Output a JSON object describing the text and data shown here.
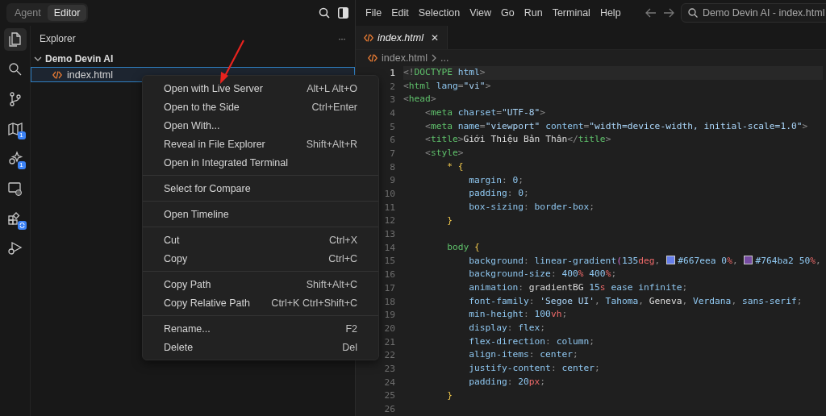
{
  "mode_toggle": [
    {
      "label": "Agent",
      "selected": false
    },
    {
      "label": "Editor",
      "selected": true
    }
  ],
  "menu_bar": [
    "File",
    "Edit",
    "Selection",
    "View",
    "Go",
    "Run",
    "Terminal",
    "Help"
  ],
  "command_center": {
    "value": "Demo Devin AI - index.html"
  },
  "activity_bar": [
    {
      "kind": "files",
      "selected": true
    },
    {
      "kind": "search",
      "selected": false
    },
    {
      "kind": "source-control",
      "selected": false
    },
    {
      "kind": "map",
      "selected": false,
      "badge": "1"
    },
    {
      "kind": "sparkle",
      "selected": false,
      "badge": "1"
    },
    {
      "kind": "remote",
      "selected": false
    },
    {
      "kind": "extensions",
      "selected": false,
      "sync": true
    },
    {
      "kind": "run",
      "selected": false
    }
  ],
  "explorer": {
    "title": "Explorer",
    "more": "···",
    "folder": {
      "name": "Demo Devin AI",
      "expanded": true,
      "children": [
        {
          "name": "index.html",
          "selected": true
        }
      ]
    }
  },
  "context_menu": [
    [
      {
        "label": "Open with Live Server",
        "shortcut": "Alt+L Alt+O"
      },
      {
        "label": "Open to the Side",
        "shortcut": "Ctrl+Enter"
      },
      {
        "label": "Open With..."
      },
      {
        "label": "Reveal in File Explorer",
        "shortcut": "Shift+Alt+R"
      },
      {
        "label": "Open in Integrated Terminal"
      }
    ],
    [
      {
        "label": "Select for Compare"
      }
    ],
    [
      {
        "label": "Open Timeline"
      }
    ],
    [
      {
        "label": "Cut",
        "shortcut": "Ctrl+X"
      },
      {
        "label": "Copy",
        "shortcut": "Ctrl+C"
      }
    ],
    [
      {
        "label": "Copy Path",
        "shortcut": "Shift+Alt+C"
      },
      {
        "label": "Copy Relative Path",
        "shortcut": "Ctrl+K Ctrl+Shift+C"
      }
    ],
    [
      {
        "label": "Rename...",
        "shortcut": "F2"
      },
      {
        "label": "Delete",
        "shortcut": "Del"
      }
    ]
  ],
  "tabs": [
    {
      "label": "index.html",
      "selected": true,
      "close": "✕"
    }
  ],
  "breadcrumb": {
    "file": "index.html",
    "rest": "..."
  },
  "code": [
    {
      "number": "1",
      "current": true,
      "tokens": [
        {
          "kind": "p",
          "text": "<!"
        },
        {
          "kind": "tag",
          "text": "DOCTYPE"
        },
        {
          "kind": "attr",
          "text": " html"
        },
        {
          "kind": "p",
          "text": ">"
        }
      ]
    },
    {
      "number": "2",
      "current": false,
      "tokens": [
        {
          "kind": "p",
          "text": "<"
        },
        {
          "kind": "tag",
          "text": "html"
        },
        {
          "kind": "attr",
          "text": " lang"
        },
        {
          "kind": "p",
          "text": "="
        },
        {
          "kind": "str",
          "text": "\"vi\""
        },
        {
          "kind": "p",
          "text": ">"
        }
      ]
    },
    {
      "number": "3",
      "current": false,
      "tokens": [
        {
          "kind": "p",
          "text": "<"
        },
        {
          "kind": "tag",
          "text": "head"
        },
        {
          "kind": "p",
          "text": ">"
        }
      ]
    },
    {
      "number": "4",
      "current": false,
      "tokens": [
        {
          "kind": "p",
          "text": "    <"
        },
        {
          "kind": "tag",
          "text": "meta"
        },
        {
          "kind": "attr",
          "text": " charset"
        },
        {
          "kind": "p",
          "text": "="
        },
        {
          "kind": "str",
          "text": "\"UTF-8\""
        },
        {
          "kind": "p",
          "text": ">"
        }
      ]
    },
    {
      "number": "5",
      "current": false,
      "tokens": [
        {
          "kind": "p",
          "text": "    <"
        },
        {
          "kind": "tag",
          "text": "meta"
        },
        {
          "kind": "attr",
          "text": " name"
        },
        {
          "kind": "p",
          "text": "="
        },
        {
          "kind": "str",
          "text": "\"viewport\""
        },
        {
          "kind": "attr",
          "text": " content"
        },
        {
          "kind": "p",
          "text": "="
        },
        {
          "kind": "str",
          "text": "\"width=device-width, initial-scale=1.0\""
        },
        {
          "kind": "p",
          "text": ">"
        }
      ]
    },
    {
      "number": "6",
      "current": false,
      "tokens": [
        {
          "kind": "p",
          "text": "    <"
        },
        {
          "kind": "tag",
          "text": "title"
        },
        {
          "kind": "p",
          "text": ">"
        },
        {
          "kind": "text",
          "text": "Giới Thiệu Bản Thân"
        },
        {
          "kind": "p",
          "text": "</"
        },
        {
          "kind": "tag",
          "text": "title"
        },
        {
          "kind": "p",
          "text": ">"
        }
      ]
    },
    {
      "number": "7",
      "current": false,
      "tokens": [
        {
          "kind": "p",
          "text": "    <"
        },
        {
          "kind": "tag",
          "text": "style"
        },
        {
          "kind": "p",
          "text": ">"
        }
      ]
    },
    {
      "number": "8",
      "current": false,
      "tokens": [
        {
          "kind": "brace",
          "text": "        * {"
        }
      ]
    },
    {
      "number": "9",
      "current": false,
      "tokens": [
        {
          "kind": "prop",
          "text": "            margin"
        },
        {
          "kind": "p",
          "text": ": "
        },
        {
          "kind": "val",
          "text": "0"
        },
        {
          "kind": "p",
          "text": ";"
        }
      ]
    },
    {
      "number": "10",
      "current": false,
      "tokens": [
        {
          "kind": "prop",
          "text": "            padding"
        },
        {
          "kind": "p",
          "text": ": "
        },
        {
          "kind": "val",
          "text": "0"
        },
        {
          "kind": "p",
          "text": ";"
        }
      ]
    },
    {
      "number": "11",
      "current": false,
      "tokens": [
        {
          "kind": "prop",
          "text": "            box-sizing"
        },
        {
          "kind": "p",
          "text": ": "
        },
        {
          "kind": "val",
          "text": "border-box"
        },
        {
          "kind": "p",
          "text": ";"
        }
      ]
    },
    {
      "number": "12",
      "current": false,
      "tokens": [
        {
          "kind": "brace",
          "text": "        }"
        }
      ]
    },
    {
      "number": "13",
      "current": false
    },
    {
      "number": "14",
      "current": false,
      "tokens": [
        {
          "kind": "sel",
          "text": "        body"
        },
        {
          "kind": "brace",
          "text": " {"
        }
      ]
    },
    {
      "number": "15",
      "current": false,
      "tokens": [
        {
          "kind": "prop",
          "text": "            background"
        },
        {
          "kind": "p",
          "text": ": "
        },
        {
          "kind": "val",
          "text": "linear-gradient"
        },
        {
          "kind": "paren",
          "text": "("
        },
        {
          "kind": "val",
          "text": "135"
        },
        {
          "kind": "unit",
          "text": "deg"
        },
        {
          "kind": "p",
          "text": ", "
        },
        {
          "kind": "swatch",
          "color": "#667eea"
        },
        {
          "kind": "val",
          "text": "#667eea 0"
        },
        {
          "kind": "unit",
          "text": "%"
        },
        {
          "kind": "p",
          "text": ", "
        },
        {
          "kind": "swatch",
          "color": "#764ba2"
        },
        {
          "kind": "val",
          "text": "#764ba2 50"
        },
        {
          "kind": "unit",
          "text": "%"
        },
        {
          "kind": "p",
          "text": ","
        }
      ]
    },
    {
      "number": "16",
      "current": false,
      "tokens": [
        {
          "kind": "prop",
          "text": "            background-size"
        },
        {
          "kind": "p",
          "text": ": "
        },
        {
          "kind": "val",
          "text": "400"
        },
        {
          "kind": "unit",
          "text": "%"
        },
        {
          "kind": "val",
          "text": " 400"
        },
        {
          "kind": "unit",
          "text": "%"
        },
        {
          "kind": "p",
          "text": ";"
        }
      ]
    },
    {
      "number": "17",
      "current": false,
      "tokens": [
        {
          "kind": "prop",
          "text": "            animation"
        },
        {
          "kind": "p",
          "text": ": "
        },
        {
          "kind": "text",
          "text": "gradientBG"
        },
        {
          "kind": "val",
          "text": " 15"
        },
        {
          "kind": "unit",
          "text": "s"
        },
        {
          "kind": "val",
          "text": " ease infinite"
        },
        {
          "kind": "p",
          "text": ";"
        }
      ]
    },
    {
      "number": "18",
      "current": false,
      "tokens": [
        {
          "kind": "prop",
          "text": "            font-family"
        },
        {
          "kind": "p",
          "text": ": "
        },
        {
          "kind": "str",
          "text": "'Segoe UI'"
        },
        {
          "kind": "p",
          "text": ", "
        },
        {
          "kind": "val",
          "text": "Tahoma"
        },
        {
          "kind": "p",
          "text": ", "
        },
        {
          "kind": "text",
          "text": "Geneva"
        },
        {
          "kind": "p",
          "text": ", "
        },
        {
          "kind": "val",
          "text": "Verdana"
        },
        {
          "kind": "p",
          "text": ", "
        },
        {
          "kind": "val",
          "text": "sans-serif"
        },
        {
          "kind": "p",
          "text": ";"
        }
      ]
    },
    {
      "number": "19",
      "current": false,
      "tokens": [
        {
          "kind": "prop",
          "text": "            min-height"
        },
        {
          "kind": "p",
          "text": ": "
        },
        {
          "kind": "val",
          "text": "100"
        },
        {
          "kind": "unit",
          "text": "vh"
        },
        {
          "kind": "p",
          "text": ";"
        }
      ]
    },
    {
      "number": "20",
      "current": false,
      "tokens": [
        {
          "kind": "prop",
          "text": "            display"
        },
        {
          "kind": "p",
          "text": ": "
        },
        {
          "kind": "val",
          "text": "flex"
        },
        {
          "kind": "p",
          "text": ";"
        }
      ]
    },
    {
      "number": "21",
      "current": false,
      "tokens": [
        {
          "kind": "prop",
          "text": "            flex-direction"
        },
        {
          "kind": "p",
          "text": ": "
        },
        {
          "kind": "val",
          "text": "column"
        },
        {
          "kind": "p",
          "text": ";"
        }
      ]
    },
    {
      "number": "22",
      "current": false,
      "tokens": [
        {
          "kind": "prop",
          "text": "            align-items"
        },
        {
          "kind": "p",
          "text": ": "
        },
        {
          "kind": "val",
          "text": "center"
        },
        {
          "kind": "p",
          "text": ";"
        }
      ]
    },
    {
      "number": "23",
      "current": false,
      "tokens": [
        {
          "kind": "prop",
          "text": "            justify-content"
        },
        {
          "kind": "p",
          "text": ": "
        },
        {
          "kind": "val",
          "text": "center"
        },
        {
          "kind": "p",
          "text": ";"
        }
      ]
    },
    {
      "number": "24",
      "current": false,
      "tokens": [
        {
          "kind": "prop",
          "text": "            padding"
        },
        {
          "kind": "p",
          "text": ": "
        },
        {
          "kind": "val",
          "text": "20"
        },
        {
          "kind": "unit",
          "text": "px"
        },
        {
          "kind": "p",
          "text": ";"
        }
      ]
    },
    {
      "number": "25",
      "current": false,
      "tokens": [
        {
          "kind": "brace",
          "text": "        }"
        }
      ]
    },
    {
      "number": "26",
      "current": false
    }
  ]
}
